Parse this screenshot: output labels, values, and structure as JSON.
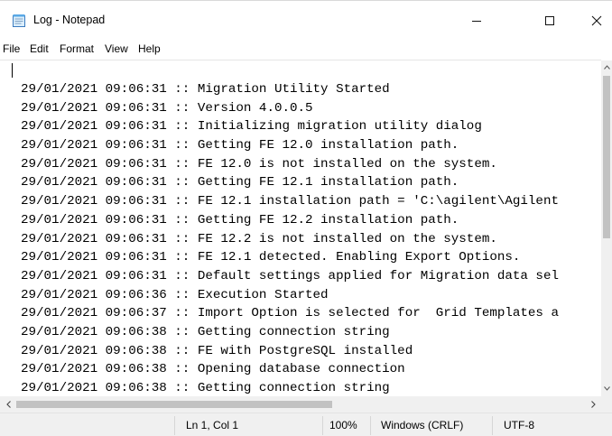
{
  "window": {
    "title": "Log - Notepad",
    "icon": "notepad-icon"
  },
  "menu": [
    "File",
    "Edit",
    "Format",
    "View",
    "Help"
  ],
  "editor": {
    "lines": [
      "29/01/2021 09:06:31 :: Migration Utility Started",
      "29/01/2021 09:06:31 :: Version 4.0.0.5",
      "29/01/2021 09:06:31 :: Initializing migration utility dialog",
      "29/01/2021 09:06:31 :: Getting FE 12.0 installation path.",
      "29/01/2021 09:06:31 :: FE 12.0 is not installed on the system.",
      "29/01/2021 09:06:31 :: Getting FE 12.1 installation path.",
      "29/01/2021 09:06:31 :: FE 12.1 installation path = 'C:\\agilent\\Agilent",
      "29/01/2021 09:06:31 :: Getting FE 12.2 installation path.",
      "29/01/2021 09:06:31 :: FE 12.2 is not installed on the system.",
      "29/01/2021 09:06:31 :: FE 12.1 detected. Enabling Export Options.",
      "29/01/2021 09:06:31 :: Default settings applied for Migration data sel",
      "29/01/2021 09:06:36 :: Execution Started",
      "29/01/2021 09:06:37 :: Import Option is selected for  Grid Templates a",
      "29/01/2021 09:06:38 :: Getting connection string",
      "29/01/2021 09:06:38 :: FE with PostgreSQL installed",
      "29/01/2021 09:06:38 :: Opening database connection",
      "29/01/2021 09:06:38 :: Getting connection string"
    ]
  },
  "status": {
    "position": "Ln 1, Col 1",
    "zoom": "100%",
    "line_ending": "Windows (CRLF)",
    "encoding": "UTF-8"
  },
  "colors": {
    "chrome": "#f0f0f0",
    "scroll_thumb": "#c2c2c2",
    "text": "#000000"
  }
}
